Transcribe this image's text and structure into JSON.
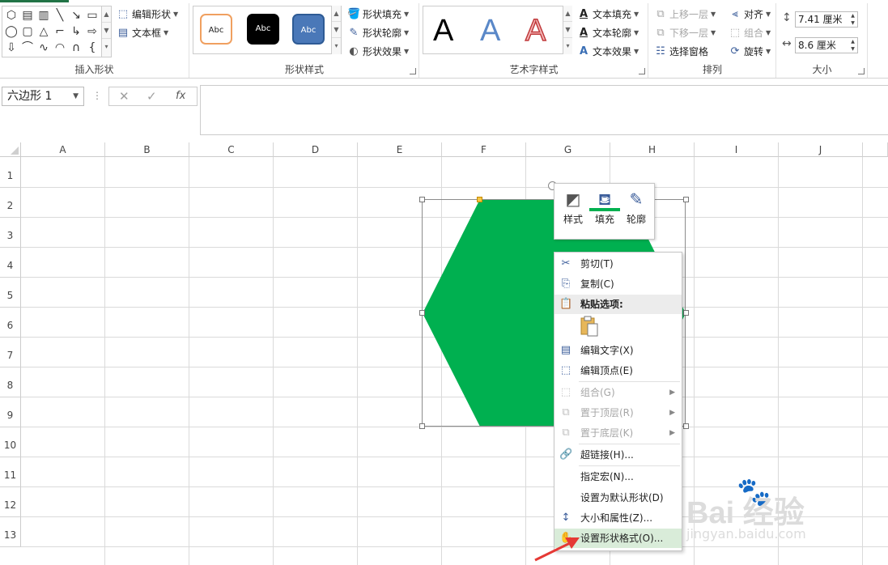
{
  "ribbon": {
    "insert_shapes": {
      "label": "插入形状",
      "edit_shape": "编辑形状",
      "text_box": "文本框"
    },
    "shape_styles": {
      "label": "形状样式",
      "preset_text": "Abc",
      "fill": "形状填充",
      "outline": "形状轮廓",
      "effects": "形状效果"
    },
    "wordart_styles": {
      "label": "艺术字样式",
      "sample": "A",
      "text_fill": "文本填充",
      "text_outline": "文本轮廓",
      "text_effects": "文本效果"
    },
    "arrange": {
      "label": "排列",
      "bring_forward": "上移一层",
      "send_backward": "下移一层",
      "selection_pane": "选择窗格",
      "align": "对齐",
      "group": "组合",
      "rotate": "旋转"
    },
    "size": {
      "label": "大小",
      "height": "7.41 厘米",
      "width": "8.6 厘米"
    }
  },
  "formula_bar": {
    "name_box": "六边形 1",
    "cancel": "✕",
    "enter": "✓",
    "fx": "fx",
    "value": ""
  },
  "grid": {
    "columns": [
      "A",
      "B",
      "C",
      "D",
      "E",
      "F",
      "G",
      "H",
      "I",
      "J"
    ],
    "rows": [
      "1",
      "2",
      "3",
      "4",
      "5",
      "6",
      "7",
      "8",
      "9",
      "10",
      "11",
      "12",
      "13"
    ]
  },
  "shape": {
    "type": "hexagon",
    "fill_color": "#00b050"
  },
  "mini_toolbar": {
    "style": "样式",
    "fill": "填充",
    "outline": "轮廓"
  },
  "context_menu": {
    "cut": "剪切(T)",
    "copy": "复制(C)",
    "paste_options": "粘贴选项:",
    "edit_text": "编辑文字(X)",
    "edit_points": "编辑顶点(E)",
    "group": "组合(G)",
    "bring_to_front": "置于顶层(R)",
    "send_to_back": "置于底层(K)",
    "hyperlink": "超链接(H)...",
    "assign_macro": "指定宏(N)...",
    "set_default": "设置为默认形状(D)",
    "size_properties": "大小和属性(Z)...",
    "format_shape": "设置形状格式(O)..."
  },
  "colors": {
    "accent_green": "#217346",
    "shape_fill": "#00b050",
    "annotation_arrow": "#e53935",
    "hover_highlight": "#d9ecd9"
  },
  "watermark": {
    "main": "Bai 经验",
    "sub": "jingyan.baidu.com"
  }
}
